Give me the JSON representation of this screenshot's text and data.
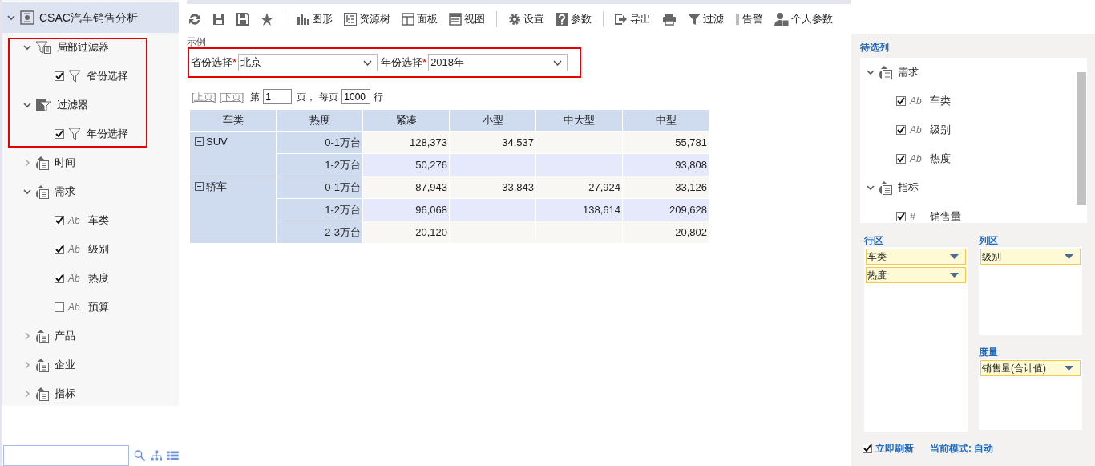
{
  "sidebar": {
    "title": "CSAC汽车销售分析",
    "expanded": true,
    "items": [
      {
        "label": "局部过滤器",
        "kind": "filter-group",
        "expanded": true,
        "children": [
          {
            "label": "省份选择",
            "kind": "filter-item",
            "checked": true
          }
        ]
      },
      {
        "label": "过滤器",
        "kind": "filter-group-solid",
        "expanded": true,
        "children": [
          {
            "label": "年份选择",
            "kind": "filter-item",
            "checked": true
          }
        ]
      },
      {
        "label": "时间",
        "kind": "folder",
        "expanded": false
      },
      {
        "label": "需求",
        "kind": "folder",
        "expanded": true,
        "children": [
          {
            "label": "车类",
            "type_mark": "Ab",
            "checked": true
          },
          {
            "label": "级别",
            "type_mark": "Ab",
            "checked": true
          },
          {
            "label": "热度",
            "type_mark": "Ab",
            "checked": true
          },
          {
            "label": "预算",
            "type_mark": "Ab",
            "checked": false
          }
        ]
      },
      {
        "label": "产品",
        "kind": "folder",
        "expanded": false
      },
      {
        "label": "企业",
        "kind": "folder",
        "expanded": false
      },
      {
        "label": "指标",
        "kind": "folder",
        "expanded": false
      }
    ]
  },
  "toolbar": [
    {
      "kind": "refresh"
    },
    {
      "kind": "save"
    },
    {
      "kind": "save-as"
    },
    {
      "kind": "star"
    },
    {
      "kind": "separator"
    },
    {
      "kind": "chart",
      "label": "图形"
    },
    {
      "kind": "tree",
      "label": "资源树"
    },
    {
      "kind": "panel",
      "label": "面板"
    },
    {
      "kind": "view",
      "label": "视图"
    },
    {
      "kind": "separator"
    },
    {
      "kind": "gear",
      "label": "设置"
    },
    {
      "kind": "help",
      "label": "参数"
    },
    {
      "kind": "separator"
    },
    {
      "kind": "export",
      "label": "导出"
    },
    {
      "kind": "print"
    },
    {
      "kind": "filter",
      "label": "过滤"
    },
    {
      "kind": "alert",
      "label": "告警"
    },
    {
      "kind": "user",
      "label": "个人参数"
    }
  ],
  "filters": {
    "caption": "示例",
    "fields": [
      {
        "label": "省份选择",
        "required_mark": "*",
        "value": "北京"
      },
      {
        "label": "年份选择",
        "required_mark": "*",
        "value": "2018年"
      }
    ]
  },
  "pager": {
    "prev": "[上页]",
    "next": "[下页]",
    "page_prefix": "第",
    "page": "1",
    "page_suffix": "页，",
    "per_page_prefix": "每页",
    "per_page": "1000",
    "per_page_suffix": "行"
  },
  "table": {
    "columns": [
      "车类",
      "热度",
      "紧凑",
      "小型",
      "中大型",
      "中型"
    ],
    "groups": [
      {
        "label": "SUV",
        "expanded": true,
        "rows": [
          {
            "heat": "0-1万台",
            "compact": "128,373",
            "small": "34,537",
            "midsize": "55,781"
          },
          {
            "heat": "1-2万台",
            "compact": "50,276",
            "midsize": "93,808"
          }
        ]
      },
      {
        "label": "轿车",
        "expanded": true,
        "rows": [
          {
            "heat": "0-1万台",
            "compact": "87,943",
            "small": "33,843",
            "large_midsize": "27,924",
            "midsize": "33,126"
          },
          {
            "heat": "1-2万台",
            "compact": "96,068",
            "large_midsize": "138,614",
            "midsize": "209,628"
          },
          {
            "heat": "2-3万台",
            "compact": "20,120",
            "midsize": "20,802"
          }
        ]
      }
    ]
  },
  "right_panel": {
    "title": "待选列",
    "tree": [
      {
        "label": "需求",
        "kind": "folder",
        "expanded": true,
        "children": [
          {
            "label": "车类",
            "type_mark": "Ab",
            "checked": true
          },
          {
            "label": "级别",
            "type_mark": "Ab",
            "checked": true
          },
          {
            "label": "热度",
            "type_mark": "Ab",
            "checked": true
          }
        ]
      },
      {
        "label": "指标",
        "kind": "folder",
        "expanded": true,
        "children": [
          {
            "label": "销售量",
            "type_mark": "#",
            "checked": true
          }
        ]
      }
    ],
    "row_zone": {
      "title": "行区",
      "items": [
        "车类",
        "热度"
      ]
    },
    "column_zone": {
      "title": "列区",
      "items": [
        "级别"
      ]
    },
    "measure_zone": {
      "title": "度量",
      "items": [
        "销售量(合计值)"
      ]
    },
    "auto_refresh": {
      "label": "立即刷新",
      "checked": true
    },
    "mode": "当前模式: 自动"
  }
}
